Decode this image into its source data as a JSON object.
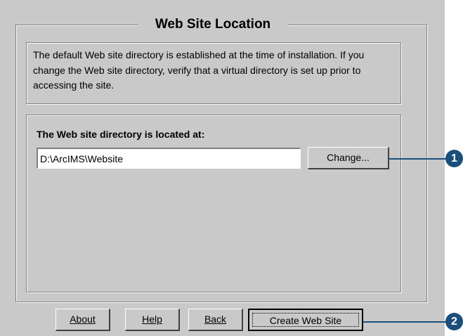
{
  "dialog": {
    "title": "Web Site Location",
    "info_text": "The default Web site directory is established at the time of installation. If you change the Web site directory, verify that a virtual directory is set up prior to accessing the site.",
    "directory_label": "The Web site directory is located at:",
    "directory_value": "D:\\ArcIMS\\Website",
    "change_button": "Change..."
  },
  "buttons": {
    "about": "About",
    "help": "Help",
    "back": "Back",
    "create": "Create Web Site"
  },
  "callouts": {
    "one": "1",
    "two": "2"
  },
  "colors": {
    "dialog_bg": "#c9c9c9",
    "callout": "#1a4f7c"
  }
}
